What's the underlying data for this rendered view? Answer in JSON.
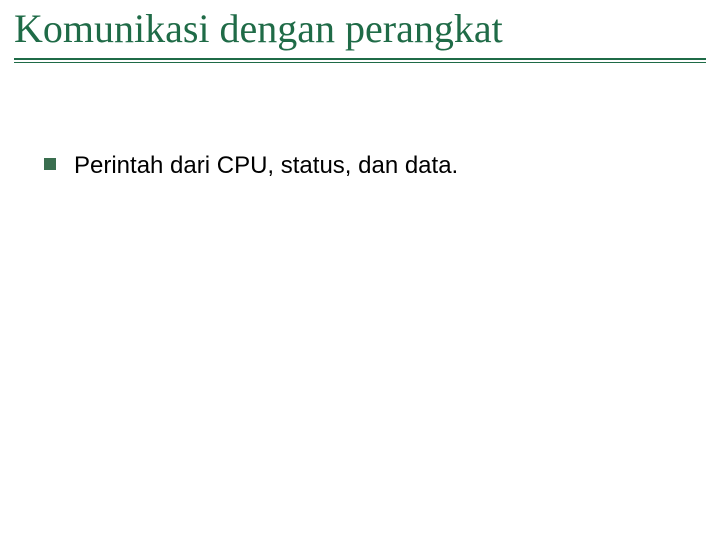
{
  "slide": {
    "title": "Komunikasi dengan perangkat",
    "bullets": [
      {
        "text": "Perintah dari CPU, status, dan data."
      }
    ]
  }
}
